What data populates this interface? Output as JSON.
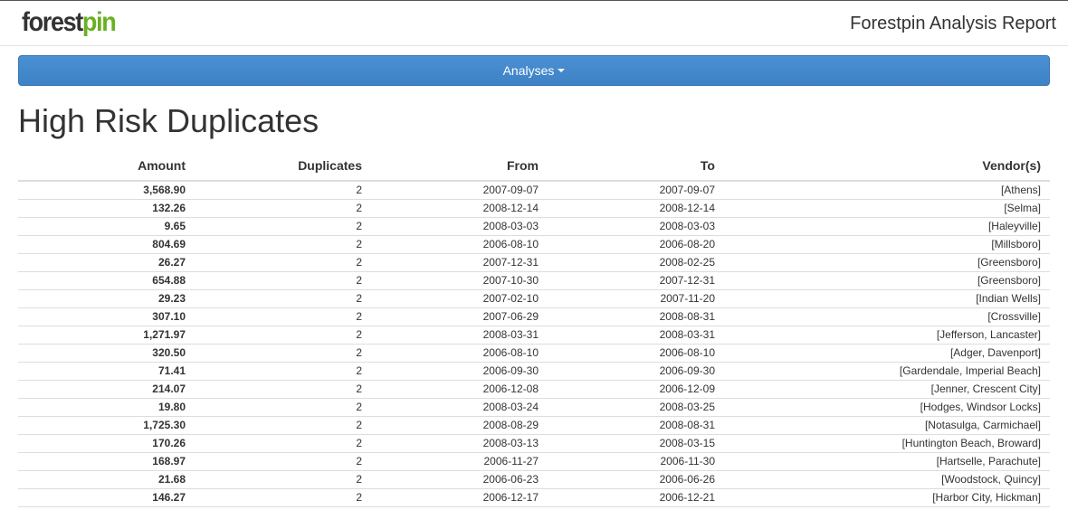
{
  "header": {
    "logo_part1": "forest",
    "logo_part2": "pin",
    "report_title": "Forestpin Analysis Report"
  },
  "navbar": {
    "analyses_label": "Analyses"
  },
  "page": {
    "title": "High Risk Duplicates"
  },
  "colors": {
    "navbar_blue": "#428bca",
    "logo_green": "#6ab023"
  },
  "table": {
    "headers": {
      "amount": "Amount",
      "duplicates": "Duplicates",
      "from": "From",
      "to": "To",
      "vendors": "Vendor(s)"
    },
    "rows": [
      {
        "amount": "3,568.90",
        "duplicates": "2",
        "from": "2007-09-07",
        "to": "2007-09-07",
        "vendors": "[Athens]"
      },
      {
        "amount": "132.26",
        "duplicates": "2",
        "from": "2008-12-14",
        "to": "2008-12-14",
        "vendors": "[Selma]"
      },
      {
        "amount": "9.65",
        "duplicates": "2",
        "from": "2008-03-03",
        "to": "2008-03-03",
        "vendors": "[Haleyville]"
      },
      {
        "amount": "804.69",
        "duplicates": "2",
        "from": "2006-08-10",
        "to": "2006-08-20",
        "vendors": "[Millsboro]"
      },
      {
        "amount": "26.27",
        "duplicates": "2",
        "from": "2007-12-31",
        "to": "2008-02-25",
        "vendors": "[Greensboro]"
      },
      {
        "amount": "654.88",
        "duplicates": "2",
        "from": "2007-10-30",
        "to": "2007-12-31",
        "vendors": "[Greensboro]"
      },
      {
        "amount": "29.23",
        "duplicates": "2",
        "from": "2007-02-10",
        "to": "2007-11-20",
        "vendors": "[Indian Wells]"
      },
      {
        "amount": "307.10",
        "duplicates": "2",
        "from": "2007-06-29",
        "to": "2008-08-31",
        "vendors": "[Crossville]"
      },
      {
        "amount": "1,271.97",
        "duplicates": "2",
        "from": "2008-03-31",
        "to": "2008-03-31",
        "vendors": "[Jefferson, Lancaster]"
      },
      {
        "amount": "320.50",
        "duplicates": "2",
        "from": "2006-08-10",
        "to": "2006-08-10",
        "vendors": "[Adger, Davenport]"
      },
      {
        "amount": "71.41",
        "duplicates": "2",
        "from": "2006-09-30",
        "to": "2006-09-30",
        "vendors": "[Gardendale, Imperial Beach]"
      },
      {
        "amount": "214.07",
        "duplicates": "2",
        "from": "2006-12-08",
        "to": "2006-12-09",
        "vendors": "[Jenner, Crescent City]"
      },
      {
        "amount": "19.80",
        "duplicates": "2",
        "from": "2008-03-24",
        "to": "2008-03-25",
        "vendors": "[Hodges, Windsor Locks]"
      },
      {
        "amount": "1,725.30",
        "duplicates": "2",
        "from": "2008-08-29",
        "to": "2008-08-31",
        "vendors": "[Notasulga, Carmichael]"
      },
      {
        "amount": "170.26",
        "duplicates": "2",
        "from": "2008-03-13",
        "to": "2008-03-15",
        "vendors": "[Huntington Beach, Broward]"
      },
      {
        "amount": "168.97",
        "duplicates": "2",
        "from": "2006-11-27",
        "to": "2006-11-30",
        "vendors": "[Hartselle, Parachute]"
      },
      {
        "amount": "21.68",
        "duplicates": "2",
        "from": "2006-06-23",
        "to": "2006-06-26",
        "vendors": "[Woodstock, Quincy]"
      },
      {
        "amount": "146.27",
        "duplicates": "2",
        "from": "2006-12-17",
        "to": "2006-12-21",
        "vendors": "[Harbor City, Hickman]"
      }
    ]
  }
}
